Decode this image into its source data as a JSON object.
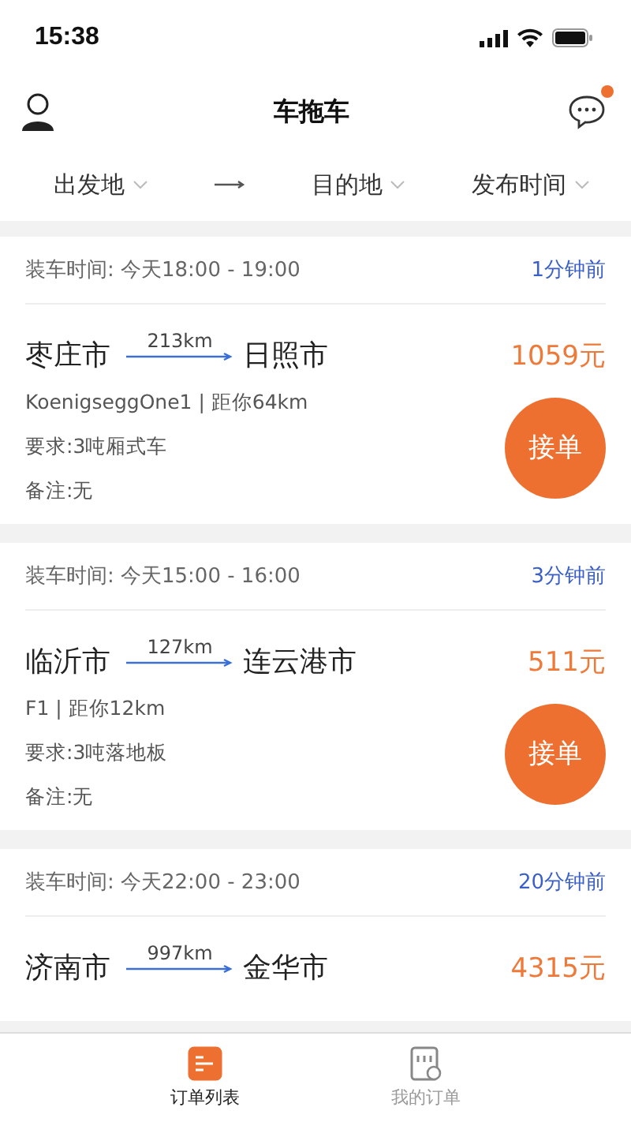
{
  "status_bar": {
    "time": "15:38"
  },
  "header": {
    "title": "车拖车",
    "has_unread": true
  },
  "filters": [
    {
      "label": "出发地"
    },
    {
      "label": "目的地"
    },
    {
      "label": "发布时间"
    }
  ],
  "orders": [
    {
      "load_time": "装车时间: 今天18:00 - 19:00",
      "posted": "1分钟前",
      "from": "枣庄市",
      "distance": "213km",
      "to": "日照市",
      "price": "1059元",
      "info": "KoenigseggOne1 | 距你64km",
      "requirement": "要求:3吨厢式车",
      "note": "备注:无",
      "action": "接单"
    },
    {
      "load_time": "装车时间: 今天15:00 - 16:00",
      "posted": "3分钟前",
      "from": "临沂市",
      "distance": "127km",
      "to": "连云港市",
      "price": "511元",
      "info": "F1 | 距你12km",
      "requirement": "要求:3吨落地板",
      "note": "备注:无",
      "action": "接单"
    },
    {
      "load_time": "装车时间: 今天22:00 - 23:00",
      "posted": "20分钟前",
      "from": "济南市",
      "distance": "997km",
      "to": "金华市",
      "price": "4315元"
    }
  ],
  "tabbar": [
    {
      "label": "订单列表",
      "selected": true
    },
    {
      "label": "我的订单",
      "selected": false
    }
  ]
}
